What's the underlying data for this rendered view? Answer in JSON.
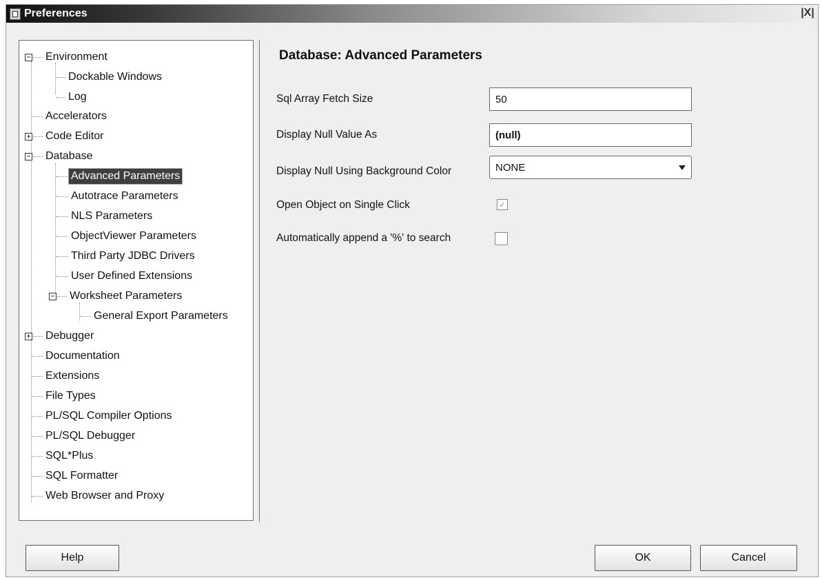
{
  "window": {
    "title": "Preferences",
    "close_label": "|X|"
  },
  "tree": {
    "items": [
      {
        "label": "Environment",
        "toggle": "−"
      },
      {
        "label": "Dockable Windows"
      },
      {
        "label": "Log"
      },
      {
        "label": "Accelerators"
      },
      {
        "label": "Code Editor",
        "toggle": "+"
      },
      {
        "label": "Database",
        "toggle": "−"
      },
      {
        "label": "Advanced Parameters",
        "selected": true
      },
      {
        "label": "Autotrace Parameters"
      },
      {
        "label": "NLS Parameters"
      },
      {
        "label": "ObjectViewer Parameters"
      },
      {
        "label": "Third Party JDBC Drivers"
      },
      {
        "label": "User Defined Extensions"
      },
      {
        "label": "Worksheet Parameters",
        "toggle": "−"
      },
      {
        "label": "General Export Parameters"
      },
      {
        "label": "Debugger",
        "toggle": "+"
      },
      {
        "label": "Documentation"
      },
      {
        "label": "Extensions"
      },
      {
        "label": "File Types"
      },
      {
        "label": "PL/SQL Compiler Options"
      },
      {
        "label": "PL/SQL Debugger"
      },
      {
        "label": "SQL*Plus"
      },
      {
        "label": "SQL Formatter"
      },
      {
        "label": "Web Browser and Proxy"
      }
    ]
  },
  "panel": {
    "title": "Database: Advanced Parameters",
    "fields": {
      "fetch_size": {
        "label": "Sql Array Fetch Size",
        "value": "50"
      },
      "null_value": {
        "label": "Display Null Value As",
        "value": "(null)"
      },
      "null_color": {
        "label": "Display Null Using Background Color",
        "value": "NONE"
      },
      "single_click": {
        "label": "Open Object on Single Click",
        "checked": true
      },
      "append_percent": {
        "label": "Automatically append a '%' to search",
        "checked": false
      }
    }
  },
  "buttons": {
    "help": "Help",
    "ok": "OK",
    "cancel": "Cancel"
  }
}
